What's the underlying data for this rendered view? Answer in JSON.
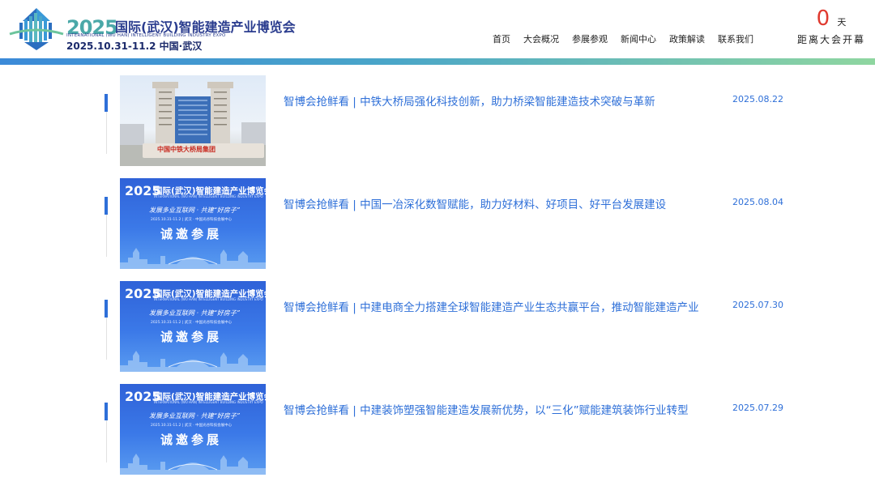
{
  "header": {
    "logo": {
      "year": "2025",
      "title": "国际(武汉)智能建造产业博览会",
      "en": "INTERNATIONAL (WU HAN) INTELLIGENT BUILDING INDUSTRY EXPO",
      "date": "2025.10.31-11.2  中国·武汉"
    },
    "nav": [
      "首页",
      "大会概况",
      "参展参观",
      "新闻中心",
      "政策解读",
      "联系我们"
    ],
    "countdown": {
      "number": "0",
      "unit": "天",
      "label": "距离大会开幕"
    }
  },
  "poster": {
    "year": "2025",
    "title": "国际(武汉)智能建造产业博览会",
    "en": "INTERNATIONAL (WU HAN) INTELLIGENT BUILDING INDUSTRY EXPO",
    "slogan": "发展多业互联网 · 共建“好房子”",
    "sub": "2025.10.31-11.2 | 武汉 · 中国光谷科技会展中心",
    "invite": "诚邀参展"
  },
  "photo": {
    "sign": "中国中铁大桥局集团"
  },
  "news": [
    {
      "title": "智博会抢鲜看 | 中铁大桥局强化科技创新，助力桥梁智能建造技术突破与革新",
      "date": "2025.08.22",
      "thumb": "photo"
    },
    {
      "title": "智博会抢鲜看 | 中国一冶深化数智赋能，助力好材料、好项目、好平台发展建设",
      "date": "2025.08.04",
      "thumb": "poster"
    },
    {
      "title": "智博会抢鲜看 | 中建电商全力搭建全球智能建造产业生态共赢平台，推动智能建造产业",
      "date": "2025.07.30",
      "thumb": "poster"
    },
    {
      "title": "智博会抢鲜看 | 中建装饰塑强智能建造发展新优势，以“三化”赋能建筑装饰行业转型",
      "date": "2025.07.29",
      "thumb": "poster"
    }
  ]
}
